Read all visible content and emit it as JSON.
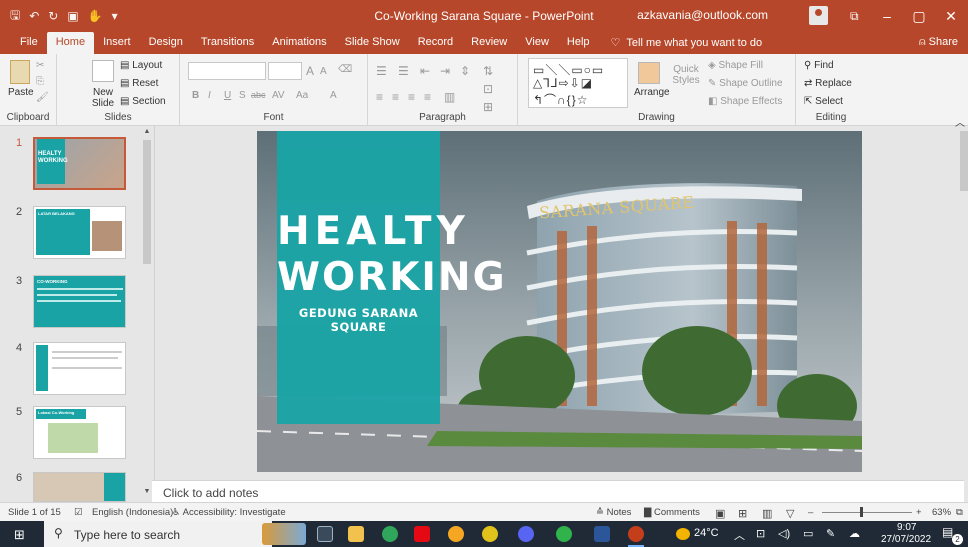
{
  "window": {
    "title": "Co-Working Sarana Square  -  PowerPoint",
    "account": "azkavania@outlook.com"
  },
  "tabs": [
    "File",
    "Home",
    "Insert",
    "Design",
    "Transitions",
    "Animations",
    "Slide Show",
    "Record",
    "Review",
    "View",
    "Help"
  ],
  "tell_me": "Tell me what you want to do",
  "share": "Share",
  "ribbon": {
    "clipboard": {
      "paste": "Paste",
      "label": "Clipboard"
    },
    "slides": {
      "new_slide": "New Slide",
      "layout": "Layout",
      "reset": "Reset",
      "section": "Section",
      "label": "Slides"
    },
    "font": {
      "label": "Font",
      "bold": "B",
      "italic": "I",
      "underline": "U",
      "strike": "S",
      "abc": "abc",
      "grow": "A",
      "shrink": "A",
      "aa": "Aa",
      "fontcolor": "A"
    },
    "paragraph": {
      "label": "Paragraph"
    },
    "drawing": {
      "arrange": "Arrange",
      "quick_styles": "Quick Styles",
      "shape_fill": "Shape Fill",
      "shape_outline": "Shape Outline",
      "shape_effects": "Shape Effects",
      "label": "Drawing"
    },
    "editing": {
      "find": "Find",
      "replace": "Replace",
      "select": "Select",
      "label": "Editing"
    }
  },
  "slides_panel": {
    "numbers": [
      "1",
      "2",
      "3",
      "4",
      "5",
      "6"
    ],
    "thumb1_lines": [
      "HEALTY",
      "WORKING"
    ],
    "thumb2_heading": "LATAR BELAKANG",
    "thumb3_heading": "CO-WORKING",
    "thumb5_heading": "Lokasi Co-Working"
  },
  "slide": {
    "title_line1": "HEALTY",
    "title_line2": "WORKING",
    "subtitle": "GEDUNG SARANA SQUARE",
    "building_sign": "SARANA SQUARE"
  },
  "notes_placeholder": "Click to add notes",
  "status_bar": {
    "slide_counter": "Slide 1 of 15",
    "language": "English (Indonesia)",
    "accessibility": "Accessibility: Investigate",
    "notes": "Notes",
    "comments": "Comments",
    "zoom": "63%"
  },
  "taskbar": {
    "search_placeholder": "Type here to search",
    "weather": "24°C",
    "time": "9:07",
    "date": "27/07/2022",
    "notification_count": "2"
  },
  "colors": {
    "accent": "#b7472a",
    "teal": "#1aa3a5"
  }
}
